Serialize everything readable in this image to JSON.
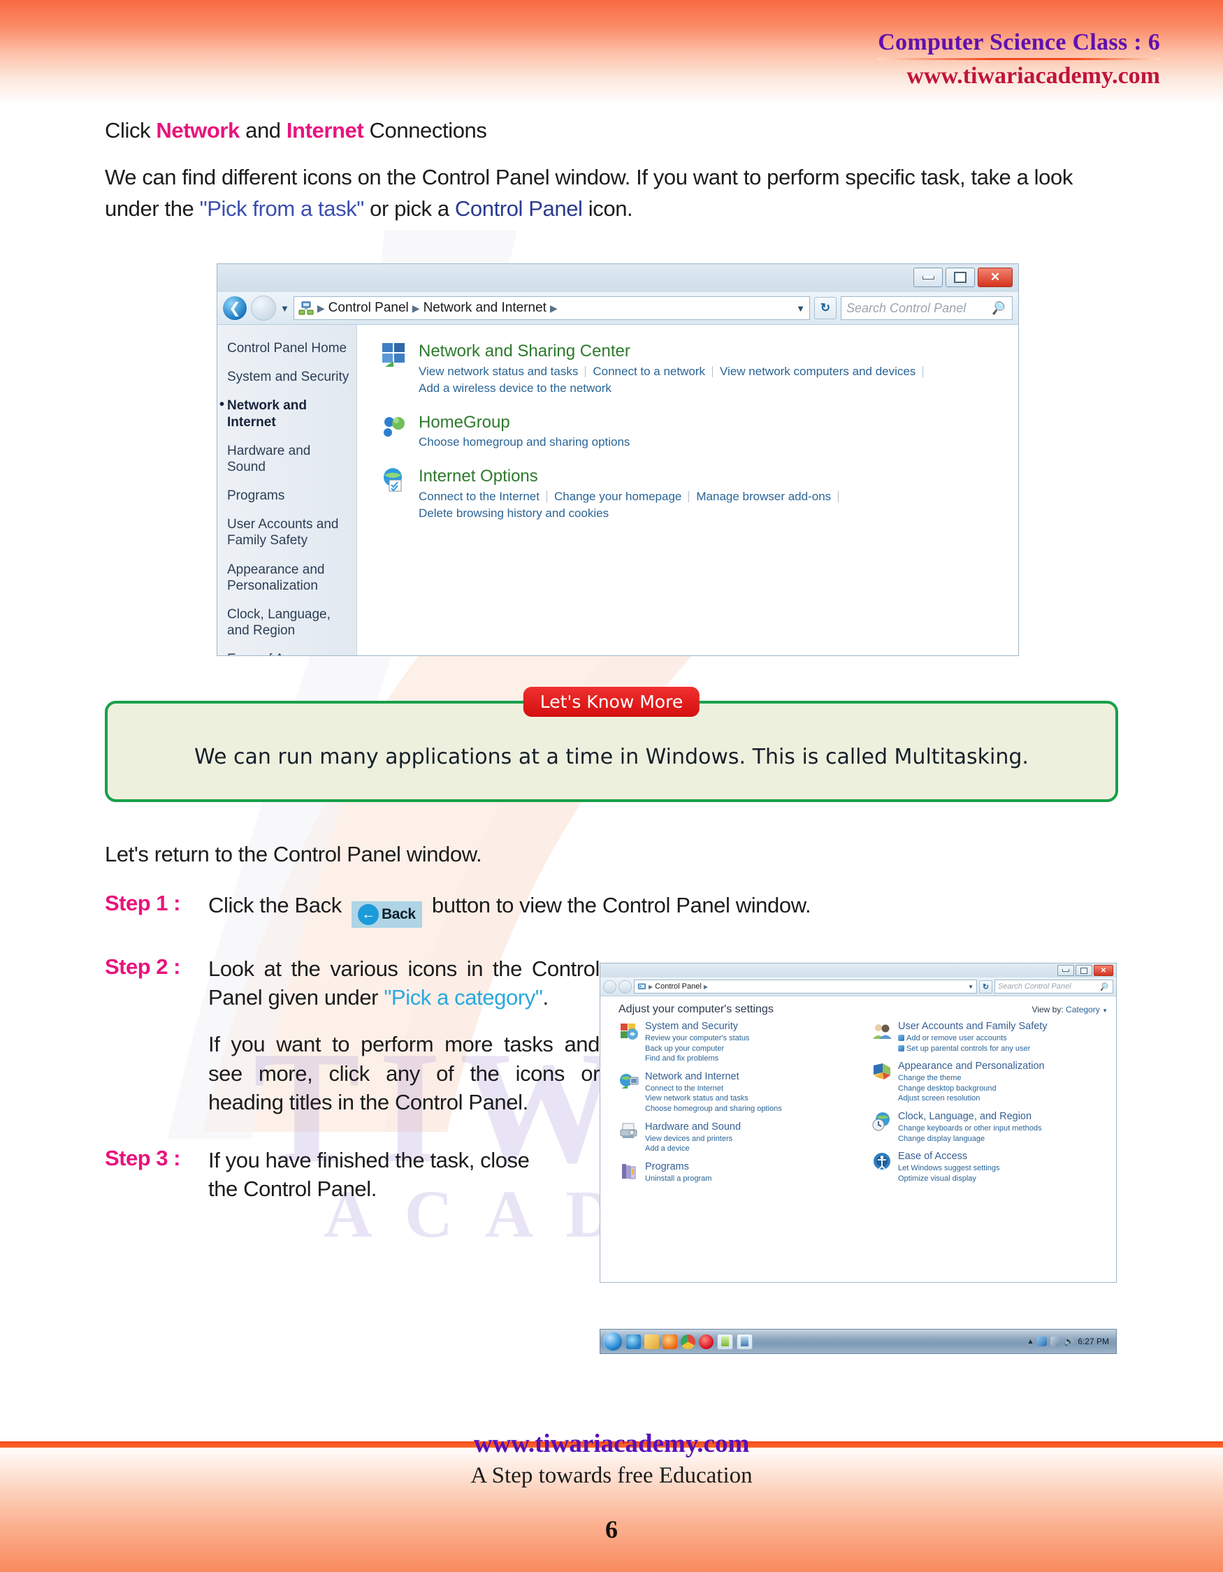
{
  "header": {
    "title": "Computer Science Class : 6",
    "site": "www.tiwariacademy.com"
  },
  "intro": {
    "line1_pre": "Click ",
    "line1_b1": "Network",
    "line1_mid": " and ",
    "line1_b2": "Internet",
    "line1_post": " Connections",
    "para1_a": "We can find different icons on the Control Panel window. If you want to perform specific task, take a look under the ",
    "para1_quote": "\"Pick from a task\"",
    "para1_b": " or pick a ",
    "para1_navy": "Control Panel",
    "para1_c": " icon."
  },
  "window1": {
    "breadcrumb": [
      "Control Panel",
      "Network and Internet"
    ],
    "search_placeholder": "Search Control Panel",
    "buttons": {
      "minimize": "minimize",
      "maximize": "maximize",
      "close": "X"
    },
    "sidebar": [
      {
        "label": "Control Panel Home",
        "selected": false
      },
      {
        "label": "System and Security",
        "selected": false
      },
      {
        "label": "Network and Internet",
        "selected": true
      },
      {
        "label": "Hardware and Sound",
        "selected": false
      },
      {
        "label": "Programs",
        "selected": false
      },
      {
        "label": "User Accounts and Family Safety",
        "selected": false
      },
      {
        "label": "Appearance and Personalization",
        "selected": false
      },
      {
        "label": "Clock, Language, and Region",
        "selected": false
      },
      {
        "label": "Ease of Access",
        "selected": false
      }
    ],
    "categories": [
      {
        "icon": "network-sharing-icon",
        "title": "Network and Sharing Center",
        "links_row1": [
          "View network status and tasks",
          "Connect to a network",
          "View network computers and devices"
        ],
        "links_row2": [
          "Add a wireless device to the network"
        ]
      },
      {
        "icon": "homegroup-icon",
        "title": "HomeGroup",
        "links_row1": [
          "Choose homegroup and sharing options"
        ],
        "links_row2": []
      },
      {
        "icon": "internet-options-icon",
        "title": "Internet Options",
        "links_row1": [
          "Connect to the Internet",
          "Change your homepage",
          "Manage browser add-ons"
        ],
        "links_row2": [
          "Delete browsing history and cookies"
        ]
      }
    ]
  },
  "callout": {
    "badge": "Let's Know More",
    "text": "We can run many applications at a time in Windows. This is called Multitasking."
  },
  "steps": {
    "lead": "Let's return to the Control Panel window.",
    "items": [
      {
        "label": "Step 1 :",
        "text_before": "Click the Back",
        "button_label": "Back",
        "text_after": "button to view the Control Panel window."
      },
      {
        "label": "Step 2 :",
        "p1_a": "Look at the various icons in the Control Panel given under ",
        "p1_cyan": "\"Pick a category\"",
        "p1_b": ".",
        "p2": "If you want to perform more tasks and see more, click any of the icons or heading titles in the Control Panel."
      },
      {
        "label": "Step 3 :",
        "text": "If you have finished the task, close the Control Panel."
      }
    ]
  },
  "window2": {
    "breadcrumb": [
      "Control Panel"
    ],
    "search_placeholder": "Search Control Panel",
    "heading": "Adjust your computer's settings",
    "view_by_label": "View by:",
    "view_by_value": "Category",
    "left_column": [
      {
        "icon": "system-security-icon",
        "title": "System and Security",
        "links": [
          "Review your computer's status",
          "Back up your computer",
          "Find and fix problems"
        ]
      },
      {
        "icon": "network-internet-icon",
        "title": "Network and Internet",
        "links": [
          "Connect to the Internet",
          "View network status and tasks",
          "Choose homegroup and sharing options"
        ]
      },
      {
        "icon": "hardware-sound-icon",
        "title": "Hardware and Sound",
        "links": [
          "View devices and printers",
          "Add a device"
        ]
      },
      {
        "icon": "programs-icon",
        "title": "Programs",
        "links": [
          "Uninstall a program"
        ]
      }
    ],
    "right_column": [
      {
        "icon": "user-accounts-icon",
        "title": "User Accounts and Family Safety",
        "links": [
          "Add or remove user accounts",
          "Set up parental controls for any user"
        ],
        "shielded": true
      },
      {
        "icon": "appearance-icon",
        "title": "Appearance and Personalization",
        "links": [
          "Change the theme",
          "Change desktop background",
          "Adjust screen resolution"
        ],
        "shielded": false
      },
      {
        "icon": "clock-language-icon",
        "title": "Clock, Language, and Region",
        "links": [
          "Change keyboards or other input methods",
          "Change display language"
        ],
        "shielded": false
      },
      {
        "icon": "ease-of-access-icon",
        "title": "Ease of Access",
        "links": [
          "Let Windows suggest settings",
          "Optimize visual display"
        ],
        "shielded": false
      }
    ]
  },
  "taskbar": {
    "clock": "6:27 PM",
    "items": [
      "start-orb",
      "internet-explorer-icon",
      "explorer-icon",
      "firefox-icon",
      "chrome-icon",
      "opera-icon",
      "notepad-icon",
      "word-icon"
    ]
  },
  "footer": {
    "site": "www.tiwariacademy.com",
    "tagline": "A Step towards free Education",
    "page_number": "6"
  },
  "watermark": {
    "line1": "TIWARI",
    "line2": "ACADEMY"
  },
  "colors": {
    "accent_orange": "#f96a42",
    "header_purple": "#6010b0",
    "header_red": "#c0143c",
    "pink": "#e8147d",
    "cyan": "#29a8df",
    "callout_green": "#17a049",
    "callout_bg": "#eef0de",
    "badge_red": "#d40f0f"
  }
}
